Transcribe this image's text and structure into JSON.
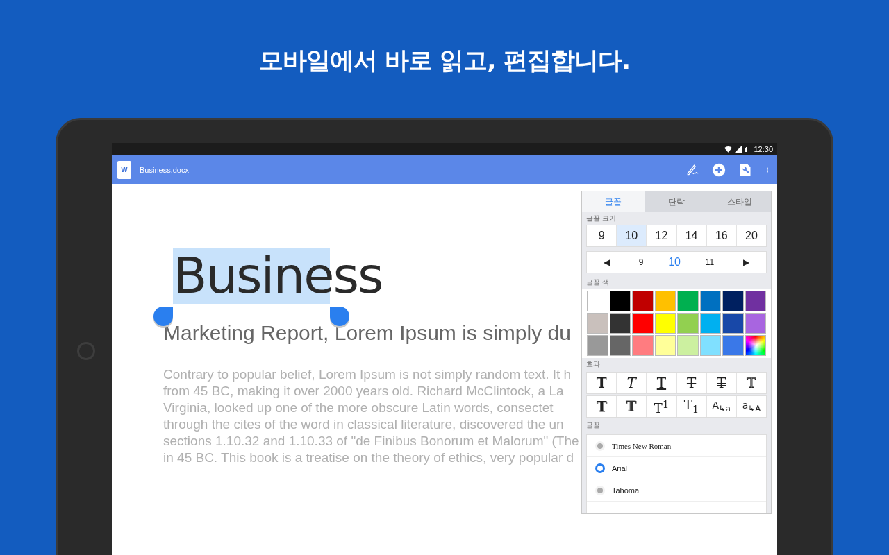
{
  "headline": "모바일에서 바로 읽고, 편집합니다.",
  "status_bar": {
    "time": "12:30"
  },
  "app_bar": {
    "doc_badge": "W",
    "title": "Business.docx"
  },
  "document": {
    "title": "Business",
    "subtitle": "Marketing Report, Lorem Ipsum is simply du",
    "body": [
      "Contrary to popular belief, Lorem Ipsum is not simply random text. It h",
      "from 45 BC, making it over 2000 years old. Richard McClintock, a La",
      "Virginia, looked up one of the more obscure Latin words, consectet",
      "through the cites of the word in classical literature, discovered the un",
      "sections 1.10.32 and 1.10.33 of \"de Finibus Bonorum et Malorum\" (The",
      "in 45 BC. This book is a treatise on the theory of ethics, very popular d"
    ]
  },
  "format_panel": {
    "tabs": [
      {
        "label": "글꼴",
        "selected": true
      },
      {
        "label": "단락",
        "selected": false
      },
      {
        "label": "스타일",
        "selected": false
      }
    ],
    "size_section": "글꼴 크기",
    "sizes": [
      {
        "label": "9",
        "selected": false
      },
      {
        "label": "10",
        "selected": true
      },
      {
        "label": "12",
        "selected": false
      },
      {
        "label": "14",
        "selected": false
      },
      {
        "label": "16",
        "selected": false
      },
      {
        "label": "20",
        "selected": false
      }
    ],
    "stepper": {
      "prev_arrow": "◀",
      "prev": "9",
      "current": "10",
      "next": "11",
      "next_arrow": "▶"
    },
    "color_section": "글꼴 색",
    "colors": [
      {
        "kind": "swatch",
        "color": "#ffffff"
      },
      {
        "kind": "swatch",
        "color": "#000000"
      },
      {
        "kind": "swatch",
        "color": "#c00000"
      },
      {
        "kind": "swatch",
        "color": "#ffc000"
      },
      {
        "kind": "swatch",
        "color": "#00b050"
      },
      {
        "kind": "swatch",
        "color": "#0070c0"
      },
      {
        "kind": "swatch",
        "color": "#002060"
      },
      {
        "kind": "swatch",
        "color": "#7030a0"
      },
      {
        "kind": "swatch",
        "color": "#c9c0bc"
      },
      {
        "kind": "swatch",
        "color": "#333333"
      },
      {
        "kind": "swatch",
        "color": "#ff0000"
      },
      {
        "kind": "swatch",
        "color": "#ffff00"
      },
      {
        "kind": "swatch",
        "color": "#92d050"
      },
      {
        "kind": "swatch",
        "color": "#00b0f0"
      },
      {
        "kind": "swatch",
        "color": "#1848a8"
      },
      {
        "kind": "swatch",
        "color": "#a865e0"
      },
      {
        "kind": "swatch",
        "color": "#999999"
      },
      {
        "kind": "swatch",
        "color": "#666666"
      },
      {
        "kind": "swatch",
        "color": "#ff7c80"
      },
      {
        "kind": "swatch",
        "color": "#ffff99"
      },
      {
        "kind": "swatch",
        "color": "#ccf0a0"
      },
      {
        "kind": "swatch",
        "color": "#80e0ff"
      },
      {
        "kind": "swatch",
        "color": "#3a78e8"
      },
      {
        "kind": "picker"
      }
    ],
    "effect_section": "효과",
    "effects": [
      [
        {
          "kind": "bold",
          "label": "T"
        },
        {
          "kind": "italic",
          "label": "T"
        },
        {
          "kind": "underline",
          "label": "T"
        },
        {
          "kind": "strike",
          "label": "T"
        },
        {
          "kind": "double-strike",
          "label": "T"
        },
        {
          "kind": "outline",
          "label": "T"
        }
      ],
      [
        {
          "kind": "shadow",
          "label": "T"
        },
        {
          "kind": "emboss",
          "label": "T"
        },
        {
          "kind": "script",
          "label": "T$^{1}$"
        },
        {
          "kind": "script",
          "label": "T$_{1}$"
        },
        {
          "kind": "case",
          "label": "A$_{↳a}$"
        },
        {
          "kind": "case",
          "label": "a$_{↳A}$"
        }
      ]
    ],
    "font_section": "글꼴",
    "fonts": [
      {
        "name": "Times New Roman",
        "kind": "serif",
        "selected": false
      },
      {
        "name": "Arial",
        "kind": "sans",
        "selected": true
      },
      {
        "name": "Tahoma",
        "kind": "sans",
        "selected": false
      }
    ]
  }
}
